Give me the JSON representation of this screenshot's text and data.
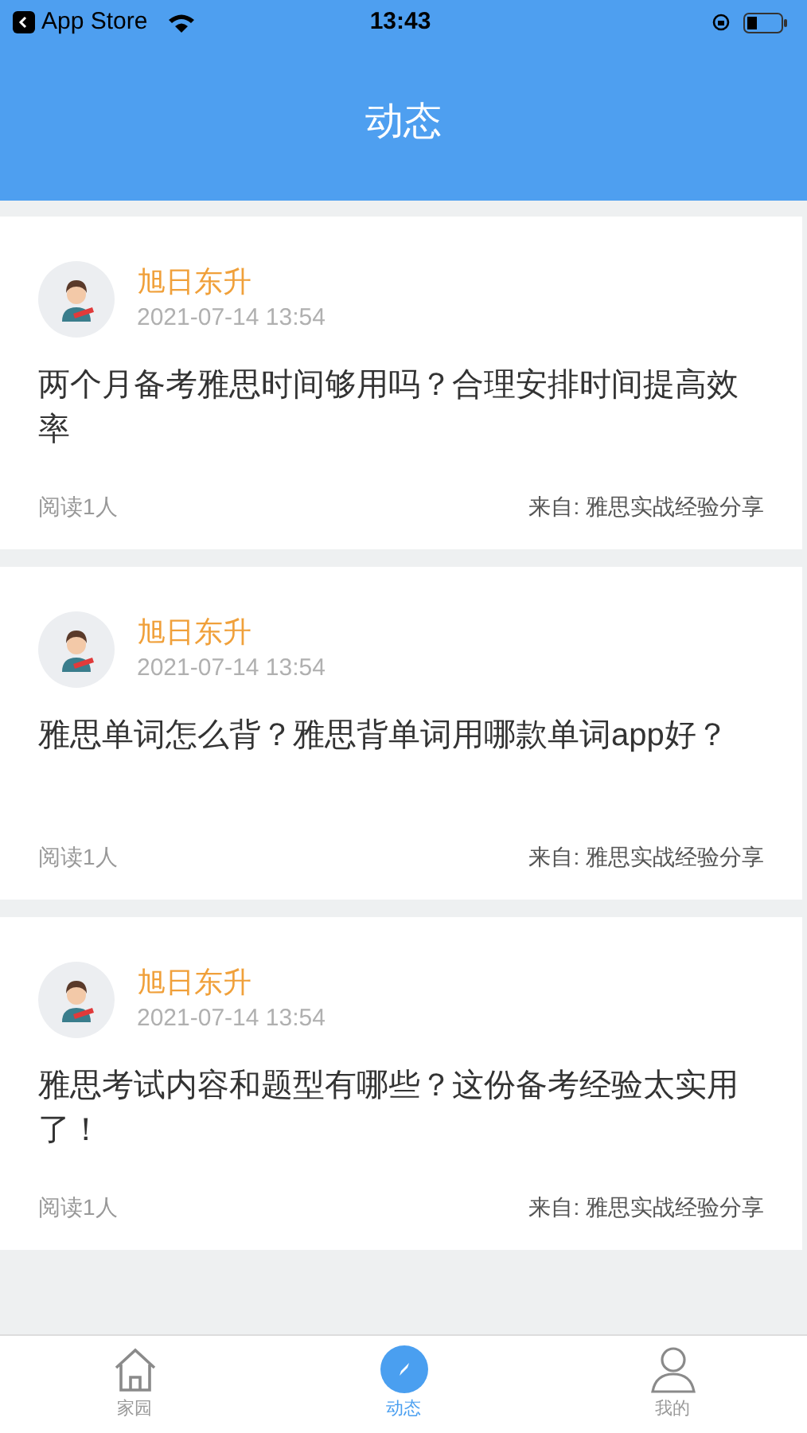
{
  "status_bar": {
    "back_label": "App Store",
    "time": "13:43"
  },
  "header": {
    "title": "动态"
  },
  "posts": [
    {
      "author": "旭日东升",
      "date": "2021-07-14 13:54",
      "title": "两个月备考雅思时间够用吗？合理安排时间提高效率",
      "reads": "阅读1人",
      "source": "来自: 雅思实战经验分享"
    },
    {
      "author": "旭日东升",
      "date": "2021-07-14 13:54",
      "title": "雅思单词怎么背？雅思背单词用哪款单词app好？",
      "reads": "阅读1人",
      "source": "来自: 雅思实战经验分享"
    },
    {
      "author": "旭日东升",
      "date": "2021-07-14 13:54",
      "title": "雅思考试内容和题型有哪些？这份备考经验太实用了！",
      "reads": "阅读1人",
      "source": "来自: 雅思实战经验分享"
    }
  ],
  "tabs": [
    {
      "label": "家园",
      "kind": "home",
      "selected": false
    },
    {
      "label": "动态",
      "kind": "feed",
      "selected": true
    },
    {
      "label": "我的",
      "kind": "profile",
      "selected": false
    }
  ]
}
